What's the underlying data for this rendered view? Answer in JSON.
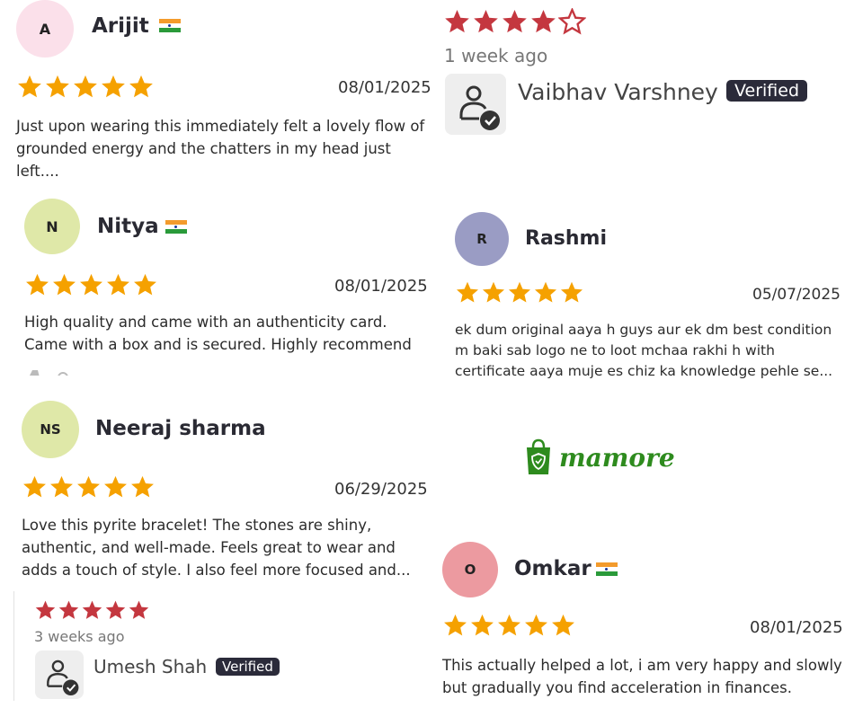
{
  "colors": {
    "star": "#f5a100",
    "star_red": "#c4373f",
    "verified_bg": "#2b2b3a",
    "brand_green": "#2e8b1e"
  },
  "reviews": {
    "arijit": {
      "initial": "A",
      "name": "Arijit",
      "rating": 5,
      "date": "08/01/2025",
      "text": "Just upon wearing this immediately felt a lovely flow of grounded energy and the chatters in my head just left....",
      "avatar_color": "#fbe0ea"
    },
    "nitya": {
      "initial": "N",
      "name": "Nitya",
      "rating": 5,
      "date": "08/01/2025",
      "text": "High quality and came with an authenticity card. Came with a box and is secured. Highly recommend",
      "avatar_color": "#dfe8a8"
    },
    "neeraj": {
      "initial": "NS",
      "name": "Neeraj sharma",
      "rating": 5,
      "date": "06/29/2025",
      "text": "Love this pyrite bracelet! The stones are shiny, authentic, and well-made. Feels great to wear and adds a touch of style. I also feel more focused and...",
      "avatar_color": "#dfe8a8"
    },
    "rashmi": {
      "initial": "R",
      "name": "Rashmi",
      "rating": 5,
      "date": "05/07/2025",
      "text": "ek dum original aaya h guys aur ek dm best condition m baki sab logo ne to loot mchaa rakhi h with certificate aaya muje es chiz ka knowledge pehle se...",
      "avatar_color": "#9a9cc4"
    },
    "omkar": {
      "initial": "O",
      "name": "Omkar",
      "rating": 5,
      "date": "08/01/2025",
      "text": "This actually helped a lot, i am very happy and slowly but gradually you find acceleration in finances.",
      "avatar_color": "#ec9aa0"
    },
    "vaibhav": {
      "name": "Vaibhav Varshney",
      "rating": 4,
      "time_ago": "1 week ago",
      "badge": "Verified"
    },
    "umesh": {
      "name": "Umesh Shah",
      "rating": 5,
      "time_ago": "3 weeks ago",
      "badge": "Verified"
    }
  },
  "brand": {
    "name": "mamore",
    "icon": "shopping-bag-shield-icon"
  }
}
